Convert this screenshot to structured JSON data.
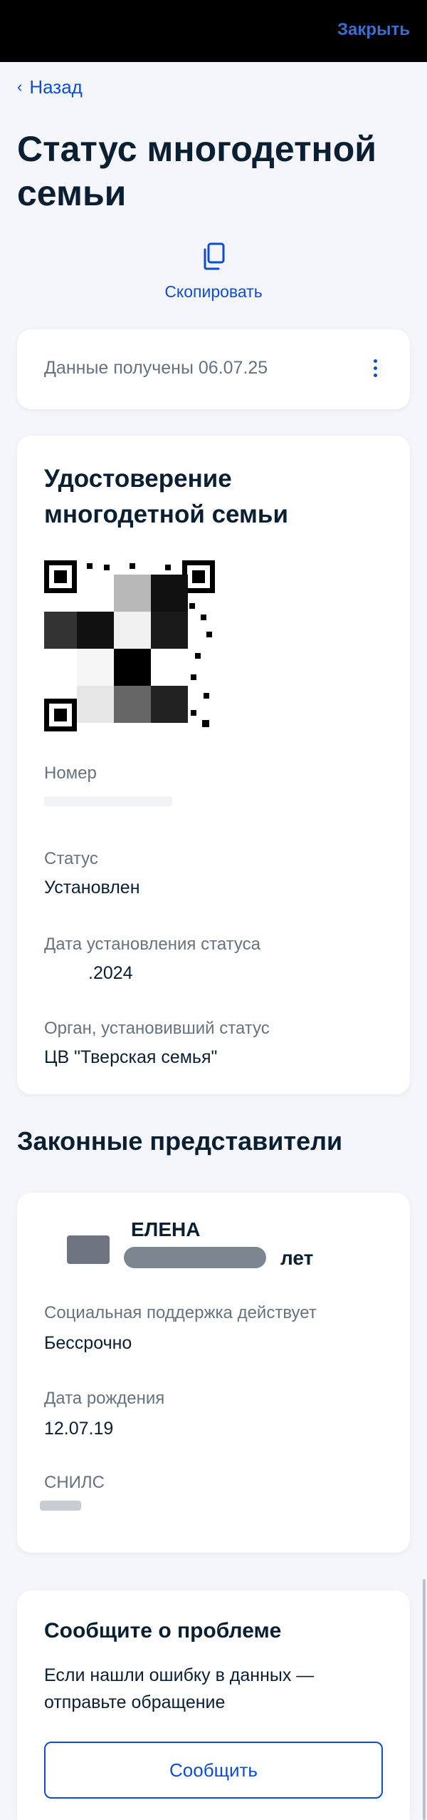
{
  "topbar": {
    "close_label": "Закрыть"
  },
  "nav": {
    "back_label": "Назад",
    "back_icon": "chevron-left-icon"
  },
  "page": {
    "title": "Статус многодетной семьи"
  },
  "copy": {
    "label": "Скопировать",
    "icon": "copy-icon"
  },
  "received": {
    "text": "Данные получены 06.07.25",
    "menu_icon": "kebab-menu-icon"
  },
  "certificate": {
    "title": "Удостоверение многодетной семьи",
    "fields": {
      "number_label": "Номер",
      "status_label": "Статус",
      "status_value": "Установлен",
      "date_label": "Дата установления статуса",
      "date_value": ".2024",
      "org_label": "Орган, установивший статус",
      "org_value": "ЦВ \"Тверская семья\""
    }
  },
  "representatives": {
    "section_title": "Законные представители",
    "person": {
      "name_visible": "ЕЛЕНА",
      "age_suffix": "лет",
      "support_label": "Социальная поддержка действует",
      "support_value": "Бессрочно",
      "birth_label": "Дата рождения",
      "birth_value": "12.07.19",
      "snils_label": "СНИЛС"
    }
  },
  "problem": {
    "title": "Сообщите о проблеме",
    "text": "Если нашли ошибку в данных — отправьте обращение",
    "button_label": "Сообщить"
  },
  "colors": {
    "accent": "#0d4cd3",
    "text": "#0b1f33",
    "muted": "#66727f",
    "background": "#f4f6fb"
  }
}
